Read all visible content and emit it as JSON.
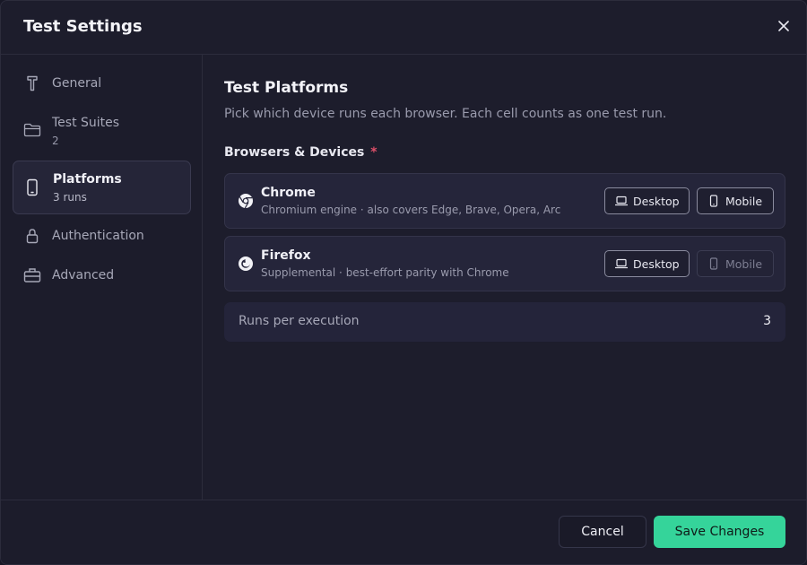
{
  "dialog": {
    "title": "Test Settings",
    "close_label": "×"
  },
  "sidebar": {
    "items": [
      {
        "label": "General",
        "sub": "",
        "icon": "brush-icon"
      },
      {
        "label": "Test Suites",
        "sub": "2",
        "icon": "folder-icon"
      },
      {
        "label": "Platforms",
        "sub": "3 runs",
        "icon": "phone-icon",
        "active": true
      },
      {
        "label": "Authentication",
        "sub": "",
        "icon": "lock-icon"
      },
      {
        "label": "Advanced",
        "sub": "",
        "icon": "briefcase-icon"
      }
    ]
  },
  "main": {
    "title": "Test Platforms",
    "description": "Pick which device runs each browser. Each cell counts as one test run.",
    "group_label": "Browsers & Devices",
    "required_mark": "*",
    "browsers": [
      {
        "name": "Chrome",
        "description": "Chromium engine · also covers Edge, Brave, Opera, Arc",
        "icon": "chrome-icon",
        "desktop": {
          "label": "Desktop",
          "selected": true
        },
        "mobile": {
          "label": "Mobile",
          "selected": true
        }
      },
      {
        "name": "Firefox",
        "description": "Supplemental · best-effort parity with Chrome",
        "icon": "firefox-icon",
        "desktop": {
          "label": "Desktop",
          "selected": true
        },
        "mobile": {
          "label": "Mobile",
          "selected": false
        }
      }
    ],
    "runs": {
      "label": "Runs per execution",
      "value": "3"
    }
  },
  "footer": {
    "cancel_label": "Cancel",
    "save_label": "Save Changes"
  },
  "colors": {
    "accent": "#35d49a",
    "required": "#e0506a",
    "background": "#1d1d2c"
  }
}
